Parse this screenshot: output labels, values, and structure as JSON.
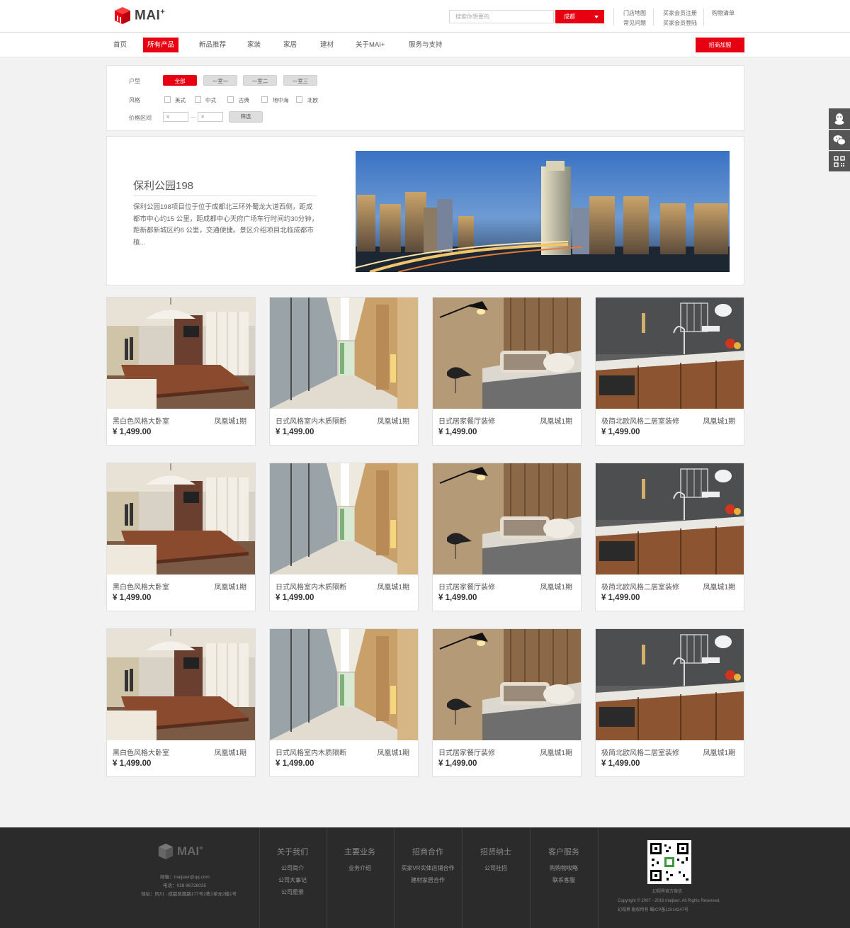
{
  "header": {
    "logo_text": "MAI",
    "logo_sup": "+",
    "search_placeholder": "搜索你想要的",
    "city": "成都",
    "links": [
      "门店地图",
      "常见问题",
      "买家会员注册",
      "买家会员登陆",
      "购物清单"
    ]
  },
  "nav": {
    "items": [
      "首页",
      "所有产品",
      "新品推荐",
      "家装",
      "家居",
      "建材",
      "关于MAI+",
      "服务与支持"
    ],
    "active_index": 1,
    "join_label": "招商加盟"
  },
  "side_tools": [
    "qq-icon",
    "wechat-icon",
    "qr-code-icon"
  ],
  "filter": {
    "type_label": "户型",
    "types": [
      "全部",
      "一室一",
      "一室二",
      "一室三"
    ],
    "style_label": "风格",
    "styles": [
      "美式",
      "中式",
      "古典",
      "地中海",
      "北欧"
    ],
    "price_label": "价格区间",
    "price_min_placeholder": "¥",
    "price_max_placeholder": "¥",
    "price_dash": "—",
    "submit_label": "筛选"
  },
  "feature": {
    "title": "保利公园198",
    "description": "保利公园198项目位于位于成都北三环外蜀龙大道西侧，距成都市中心约15 公里，距成都中心天府广场车行时间约30分钟，距新都新城区约6 公里，交通便捷。景区介绍项目北临成都市植..."
  },
  "products": {
    "rows": [
      [
        {
          "name": "黑白色风格大卧室",
          "tag": "凤凰城1期",
          "price": "¥ 1,499.00",
          "scene": "dining"
        },
        {
          "name": "日式风格室内木质隔断",
          "tag": "凤凰城1期",
          "price": "¥ 1,499.00",
          "scene": "corridor"
        },
        {
          "name": "日式居家餐厅装修",
          "tag": "凤凰城1期",
          "price": "¥ 1,499.00",
          "scene": "bedroom"
        },
        {
          "name": "极简北欧风格二居室装修",
          "tag": "凤凰城1期",
          "price": "¥ 1,499.00",
          "scene": "kitchen"
        }
      ],
      [
        {
          "name": "黑白色风格大卧室",
          "tag": "凤凰城1期",
          "price": "¥ 1,499.00",
          "scene": "dining"
        },
        {
          "name": "日式风格室内木质隔断",
          "tag": "凤凰城1期",
          "price": "¥ 1,499.00",
          "scene": "corridor"
        },
        {
          "name": "日式居家餐厅装修",
          "tag": "凤凰城1期",
          "price": "¥ 1,499.00",
          "scene": "bedroom"
        },
        {
          "name": "极简北欧风格二居室装修",
          "tag": "凤凰城1期",
          "price": "¥ 1,499.00",
          "scene": "kitchen"
        }
      ],
      [
        {
          "name": "黑白色风格大卧室",
          "tag": "凤凰城1期",
          "price": "¥ 1,499.00",
          "scene": "dining"
        },
        {
          "name": "日式风格室内木质隔断",
          "tag": "凤凰城1期",
          "price": "¥ 1,499.00",
          "scene": "corridor"
        },
        {
          "name": "日式居家餐厅装修",
          "tag": "凤凰城1期",
          "price": "¥ 1,499.00",
          "scene": "bedroom"
        },
        {
          "name": "极简北欧风格二居室装修",
          "tag": "凤凰城1期",
          "price": "¥ 1,499.00",
          "scene": "kitchen"
        }
      ]
    ]
  },
  "footer": {
    "logo_text": "MAI",
    "logo_sup": "+",
    "email": "邮箱：maijiavr@qq.com",
    "phone": "电话：028 86728035",
    "address": "地址：四川 · 成都凤凰路177号2栋1单元2楼1号",
    "columns": [
      {
        "title": "关于我们",
        "links": [
          "公司简介",
          "公司大事记",
          "公司愿景"
        ]
      },
      {
        "title": "主要业务",
        "links": [
          "业务介绍"
        ]
      },
      {
        "title": "招商合作",
        "links": [
          "买家VR实体店铺合作",
          "建材家居合作"
        ]
      },
      {
        "title": "招贤纳士",
        "links": [
          "公司社招"
        ]
      },
      {
        "title": "客户服务",
        "links": [
          "购购物攻略",
          "联系客服"
        ]
      }
    ],
    "qr_caption": "幻视界官方微信",
    "copyright": "Copyright © 2007 - 2016 maijiavr. All Rights Reserved.",
    "icp": "幻视界 版权所有   蜀ICP备12014247号"
  },
  "colors": {
    "accent": "#e60012",
    "footer_bg": "#2b2b2b",
    "page_bg": "#f2f2f2"
  }
}
